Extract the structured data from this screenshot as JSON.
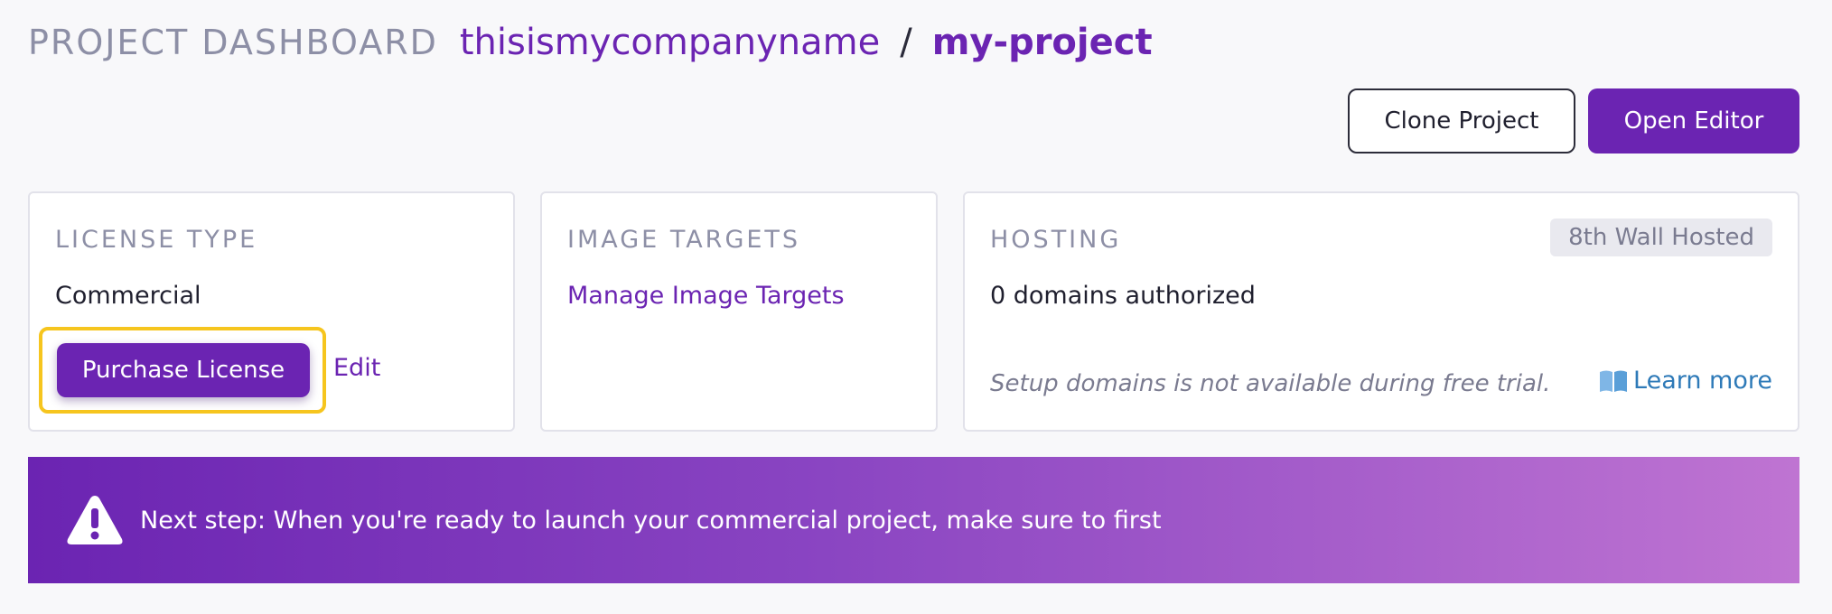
{
  "header": {
    "section": "PROJECT DASHBOARD",
    "company": "thisismycompanyname",
    "separator": "/",
    "project": "my-project"
  },
  "actions": {
    "clone_label": "Clone Project",
    "open_editor_label": "Open Editor"
  },
  "license": {
    "title": "LICENSE TYPE",
    "value": "Commercial",
    "purchase_label": "Purchase License",
    "edit_label": "Edit"
  },
  "image_targets": {
    "title": "IMAGE TARGETS",
    "manage_label": "Manage Image Targets"
  },
  "hosting": {
    "title": "HOSTING",
    "badge": "8th Wall Hosted",
    "domains": "0 domains authorized",
    "note": "Setup domains is not available during free trial.",
    "learn_more_label": "Learn more"
  },
  "banner": {
    "message": "Next step: When you're ready to launch your commercial project, make sure to first"
  },
  "colors": {
    "accent": "#6b24b2",
    "highlight": "#f6c51e",
    "link_blue": "#2e7ab8",
    "muted": "#8d8fa6"
  },
  "icons": {
    "learn_more": "book-icon",
    "banner": "warning-icon"
  }
}
